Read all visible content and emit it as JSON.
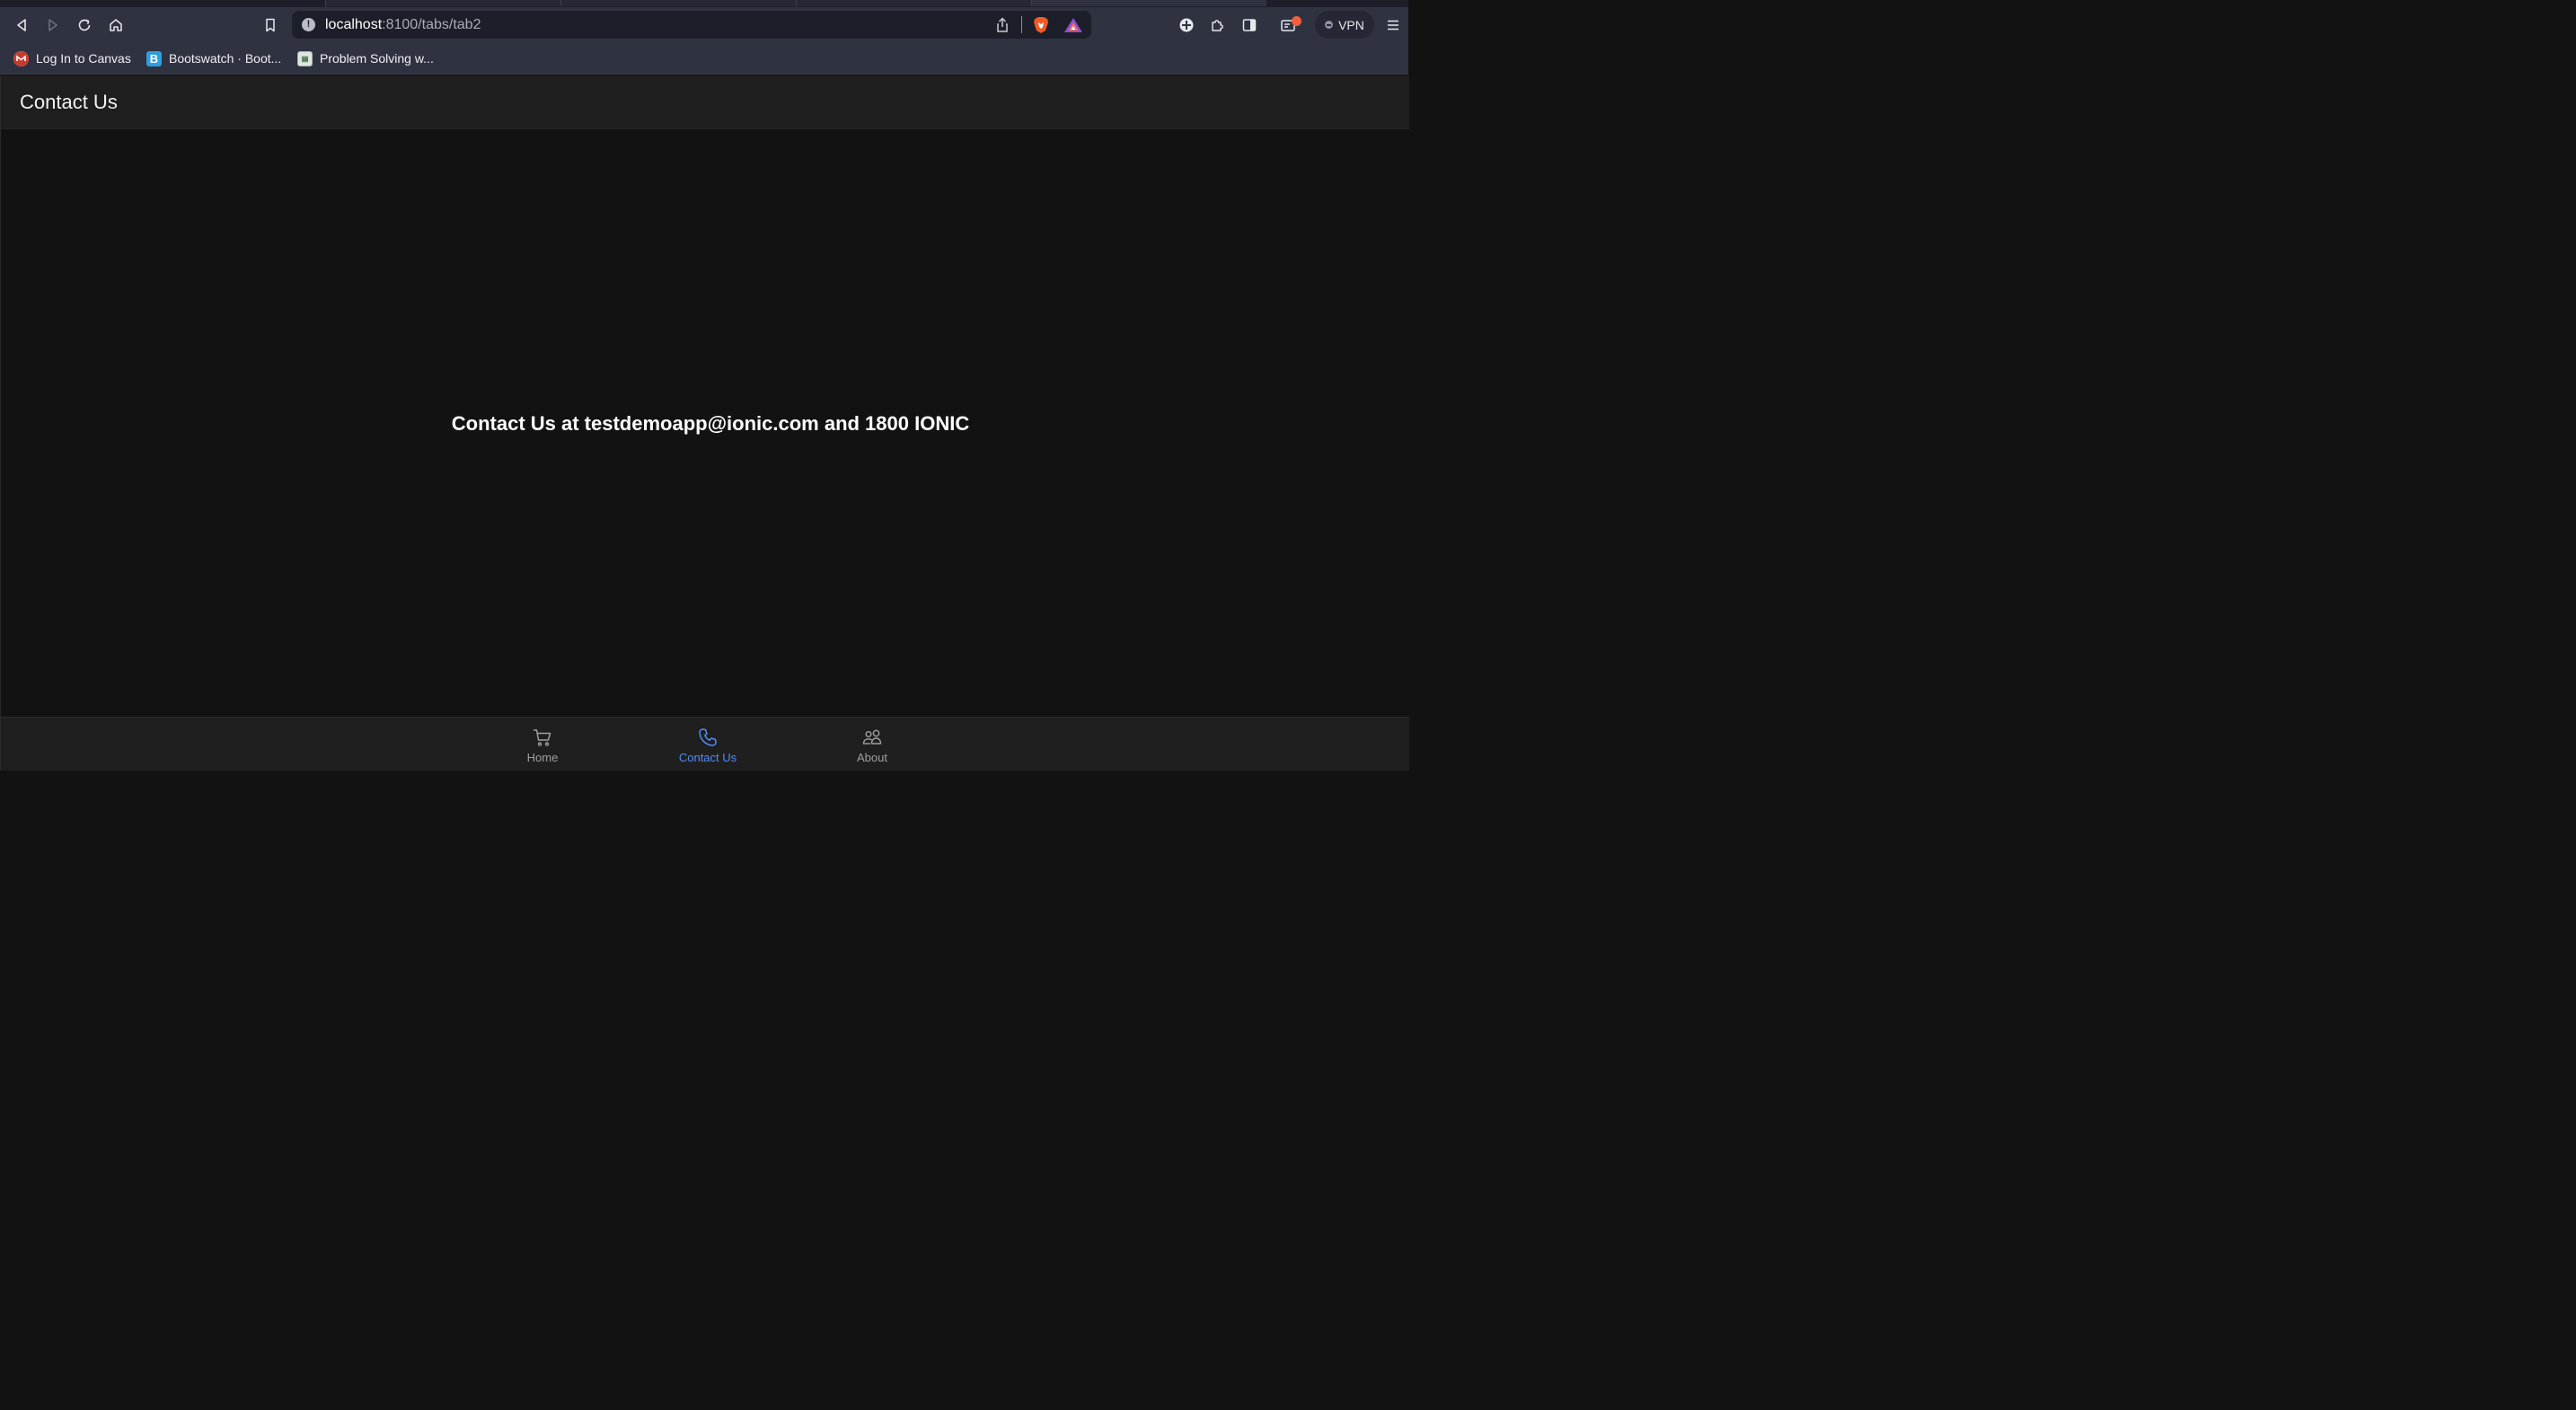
{
  "browser": {
    "url_host": "localhost",
    "url_path": ":8100/tabs/tab2",
    "vpn_label": "VPN",
    "bookmarks": [
      {
        "label": "Log In to Canvas",
        "icon": "canvas-favicon"
      },
      {
        "label": "Bootswatch · Boot...",
        "icon": "bootswatch-favicon",
        "glyph": "B"
      },
      {
        "label": "Problem Solving w...",
        "icon": "problem-solving-favicon"
      }
    ]
  },
  "app": {
    "title": "Contact Us",
    "message": "Contact Us at testdemoapp@ionic.com and 1800 IONIC",
    "tabs": [
      {
        "label": "Home",
        "icon": "cart-icon",
        "active": false
      },
      {
        "label": "Contact Us",
        "icon": "call-icon",
        "active": true
      },
      {
        "label": "About",
        "icon": "people-icon",
        "active": false
      }
    ],
    "colors": {
      "accent": "#4d8dff",
      "background": "#121212",
      "toolbar": "#1f1f1f"
    }
  }
}
